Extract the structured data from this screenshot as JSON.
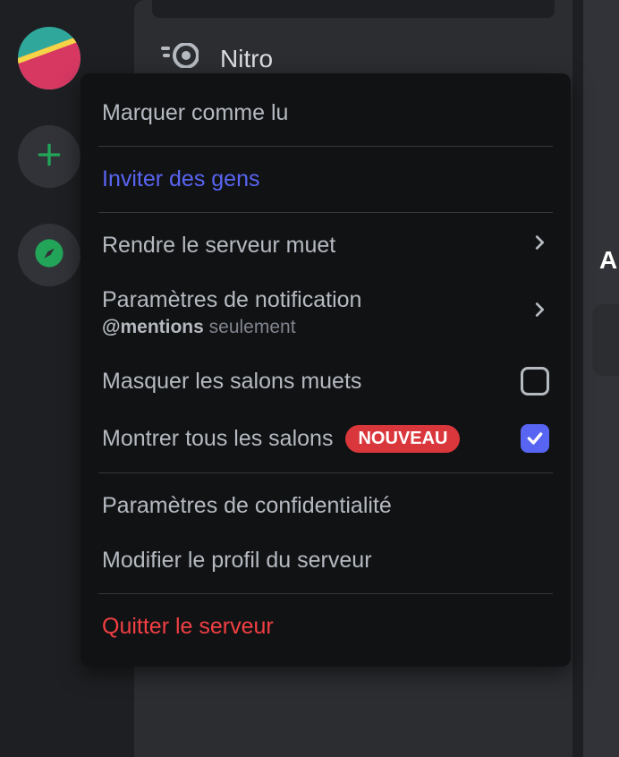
{
  "sidebar": {
    "nitro_label": "Nitro"
  },
  "right_edge_char": "A",
  "menu": {
    "mark_read": "Marquer comme lu",
    "invite": "Inviter des gens",
    "mute_server": "Rendre le serveur muet",
    "notification_settings": "Paramètres de notification",
    "notification_sub_prefix": "@mentions",
    "notification_sub_suffix": " seulement",
    "hide_muted": "Masquer les salons muets",
    "show_all": "Montrer tous les salons",
    "new_badge": "NOUVEAU",
    "privacy": "Paramètres de confidentialité",
    "edit_profile": "Modifier le profil du serveur",
    "leave": "Quitter le serveur"
  },
  "checkboxes": {
    "hide_muted_checked": false,
    "show_all_checked": true
  },
  "colors": {
    "accent": "#5865f2",
    "danger": "#f23f42",
    "badge_bg": "#da373c"
  }
}
